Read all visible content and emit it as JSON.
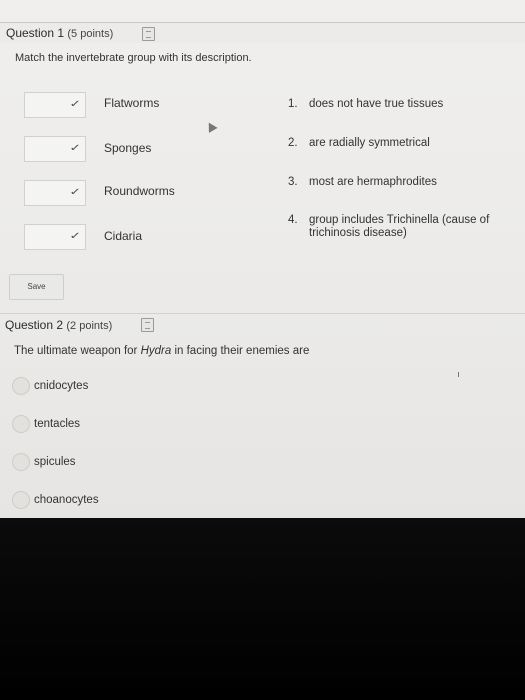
{
  "question1": {
    "title": "Question 1",
    "points": "(5 points)",
    "prompt": "Match the invertebrate group with its description.",
    "terms": [
      "Flatworms",
      "Sponges",
      "Roundworms",
      "Cidaria"
    ],
    "descriptions": [
      {
        "num": "1.",
        "line1": "does not have true tissues",
        "line2": ""
      },
      {
        "num": "2.",
        "line1": "are radially symmetrical",
        "line2": ""
      },
      {
        "num": "3.",
        "line1": "most are hermaphrodites",
        "line2": ""
      },
      {
        "num": "4.",
        "line1": "group includes Trichinella (cause of",
        "line2": "trichinosis disease)"
      }
    ],
    "select_icon": "chevron-down-icon",
    "save_label": "Save"
  },
  "question2": {
    "title": "Question 2",
    "points": "(2 points)",
    "prompt_before": "The ultimate weapon for ",
    "prompt_em": "Hydra",
    "prompt_after": " in facing their enemies are",
    "options": [
      "cnidocytes",
      "tentacles",
      "spicules",
      "choanocytes"
    ]
  }
}
